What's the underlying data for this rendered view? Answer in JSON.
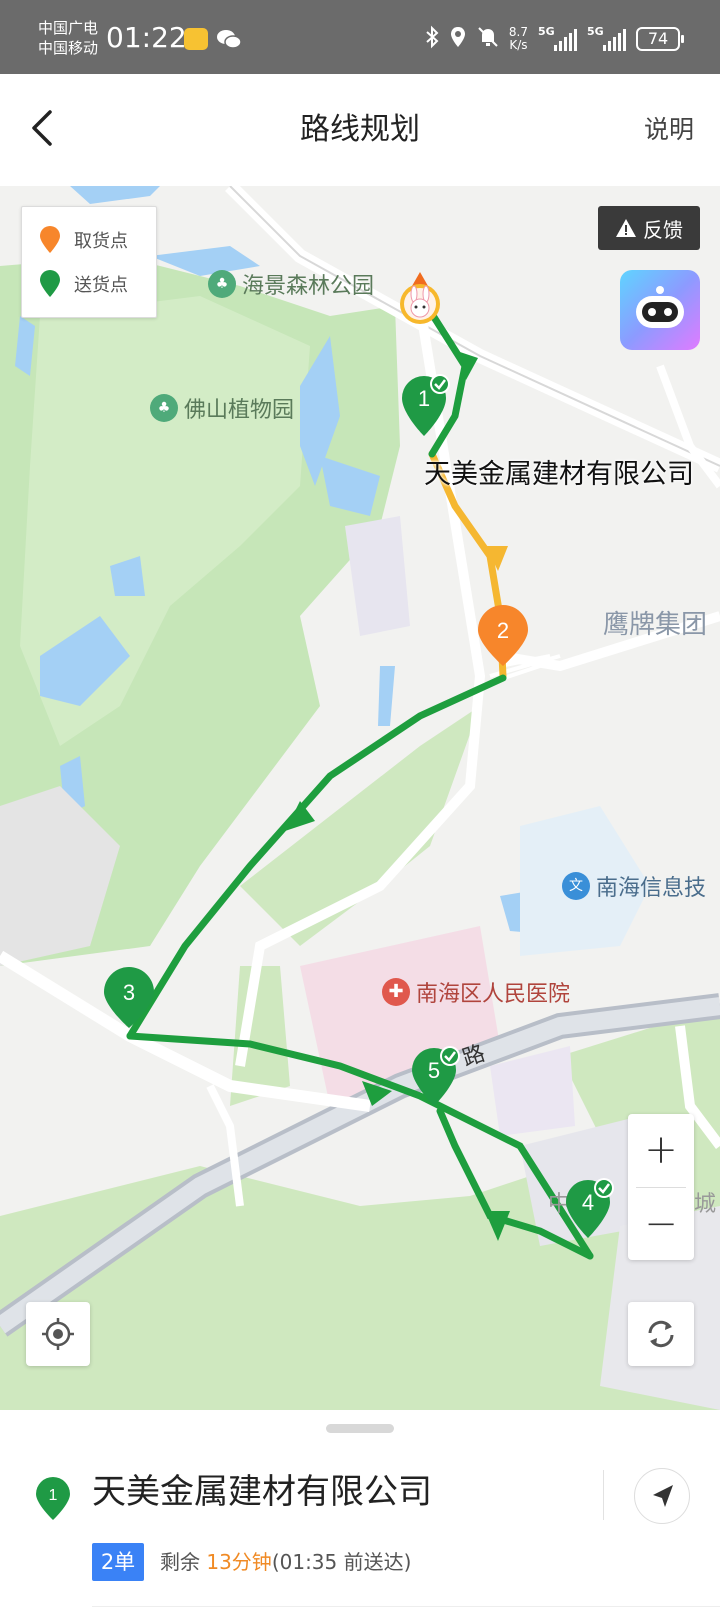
{
  "status_bar": {
    "carrier_1": "中国广电",
    "carrier_2": "中国移动",
    "time": "01:22",
    "speed_value": "8.7",
    "speed_unit": "K/s",
    "network_1": "5G",
    "network_2": "5G",
    "battery": "74"
  },
  "header": {
    "title": "路线规划",
    "help": "说明"
  },
  "map": {
    "legend": {
      "pickup": "取货点",
      "delivery": "送货点"
    },
    "feedback": "反馈",
    "pois": {
      "park_1": "海景森林公园",
      "park_2": "佛山植物园",
      "company_label": "天美金属建材有限公司",
      "group": "鹰牌集团",
      "school": "南海信息技",
      "school_icon": "文",
      "hospital": "南海区人民医院",
      "road": "路",
      "partial_4": "中",
      "partial_4b": "城"
    },
    "markers": [
      {
        "label": "1",
        "kind": "delivery",
        "done": true
      },
      {
        "label": "2",
        "kind": "pickup",
        "done": false
      },
      {
        "label": "3",
        "kind": "delivery",
        "done": false
      },
      {
        "label": "4",
        "kind": "delivery",
        "done": true
      },
      {
        "label": "5",
        "kind": "delivery",
        "done": true
      }
    ],
    "colors": {
      "route_green": "#1e9e3e",
      "route_orange": "#f5b731",
      "pickup_orange": "#f7862b",
      "delivery_green": "#1f9a45"
    },
    "zoom_in": "+",
    "zoom_out": "−"
  },
  "bottom": {
    "marker_label": "1",
    "title": "天美金属建材有限公司",
    "badge": "2单",
    "remain_prefix": "剩余 ",
    "remain_minutes": "13分钟",
    "remain_suffix": "(01:35 前送达)"
  }
}
